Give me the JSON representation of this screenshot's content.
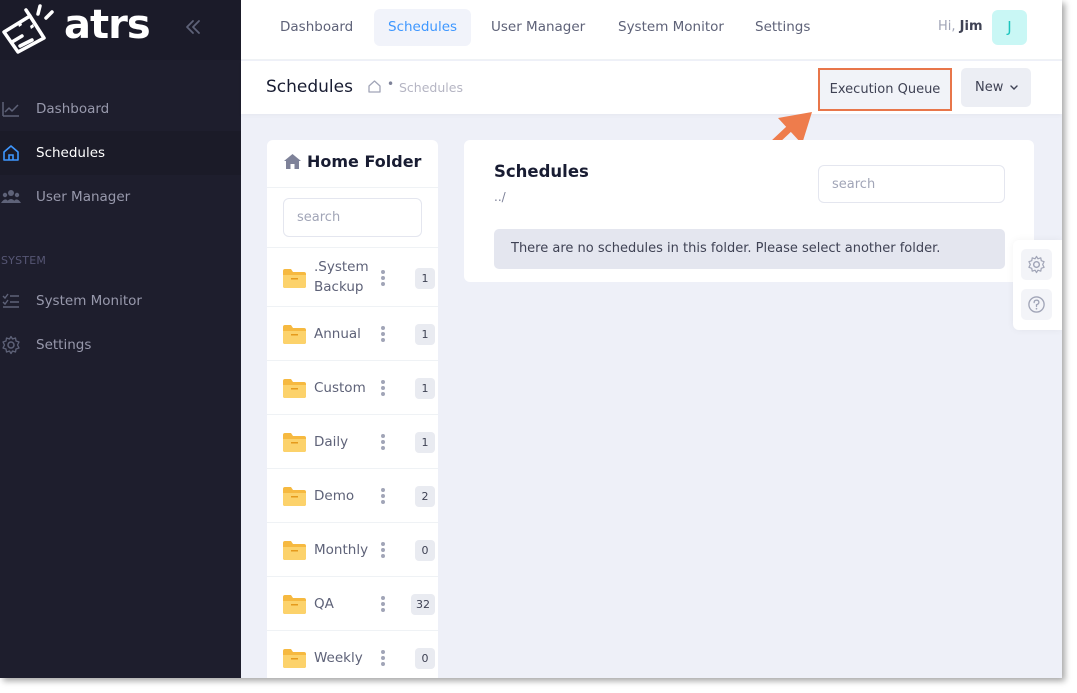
{
  "brand": {
    "logo_text": "atrs"
  },
  "sidebar": {
    "items": [
      {
        "label": "Dashboard",
        "icon": "chart-line-icon",
        "active": false
      },
      {
        "label": "Schedules",
        "icon": "home-icon",
        "active": true
      },
      {
        "label": "User Manager",
        "icon": "users-icon",
        "active": false
      }
    ],
    "section_label": "SYSTEM",
    "system_items": [
      {
        "label": "System Monitor",
        "icon": "list-check-icon"
      },
      {
        "label": "Settings",
        "icon": "gear-icon"
      }
    ]
  },
  "header": {
    "tabs": [
      {
        "label": "Dashboard",
        "active": false
      },
      {
        "label": "Schedules",
        "active": true
      },
      {
        "label": "User Manager",
        "active": false
      },
      {
        "label": "System Monitor",
        "active": false
      },
      {
        "label": "Settings",
        "active": false
      }
    ],
    "greeting_prefix": "Hi,",
    "user_name": "Jim",
    "avatar_initial": "J"
  },
  "toolbar": {
    "title": "Schedules",
    "breadcrumb_separator": "•",
    "breadcrumb_current": "Schedules",
    "execution_queue_label": "Execution Queue",
    "new_label": "New"
  },
  "folders": {
    "title": "Home Folder",
    "search_placeholder": "search",
    "items": [
      {
        "label": ".System Backup",
        "count": "1"
      },
      {
        "label": "Annual",
        "count": "1"
      },
      {
        "label": "Custom",
        "count": "1"
      },
      {
        "label": "Daily",
        "count": "1"
      },
      {
        "label": "Demo",
        "count": "2"
      },
      {
        "label": "Monthly",
        "count": "0"
      },
      {
        "label": "QA",
        "count": "32"
      },
      {
        "label": "Weekly",
        "count": "0"
      }
    ]
  },
  "main": {
    "title": "Schedules",
    "path": "../",
    "search_placeholder": "search",
    "empty_message": "There are no schedules in this folder. Please select another folder."
  },
  "colors": {
    "sidebar_bg": "#1e1e2d",
    "accent": "#3e97ff",
    "highlight": "#e8764a",
    "folder": "#f6b940",
    "avatar_bg": "#c9f7f5"
  }
}
